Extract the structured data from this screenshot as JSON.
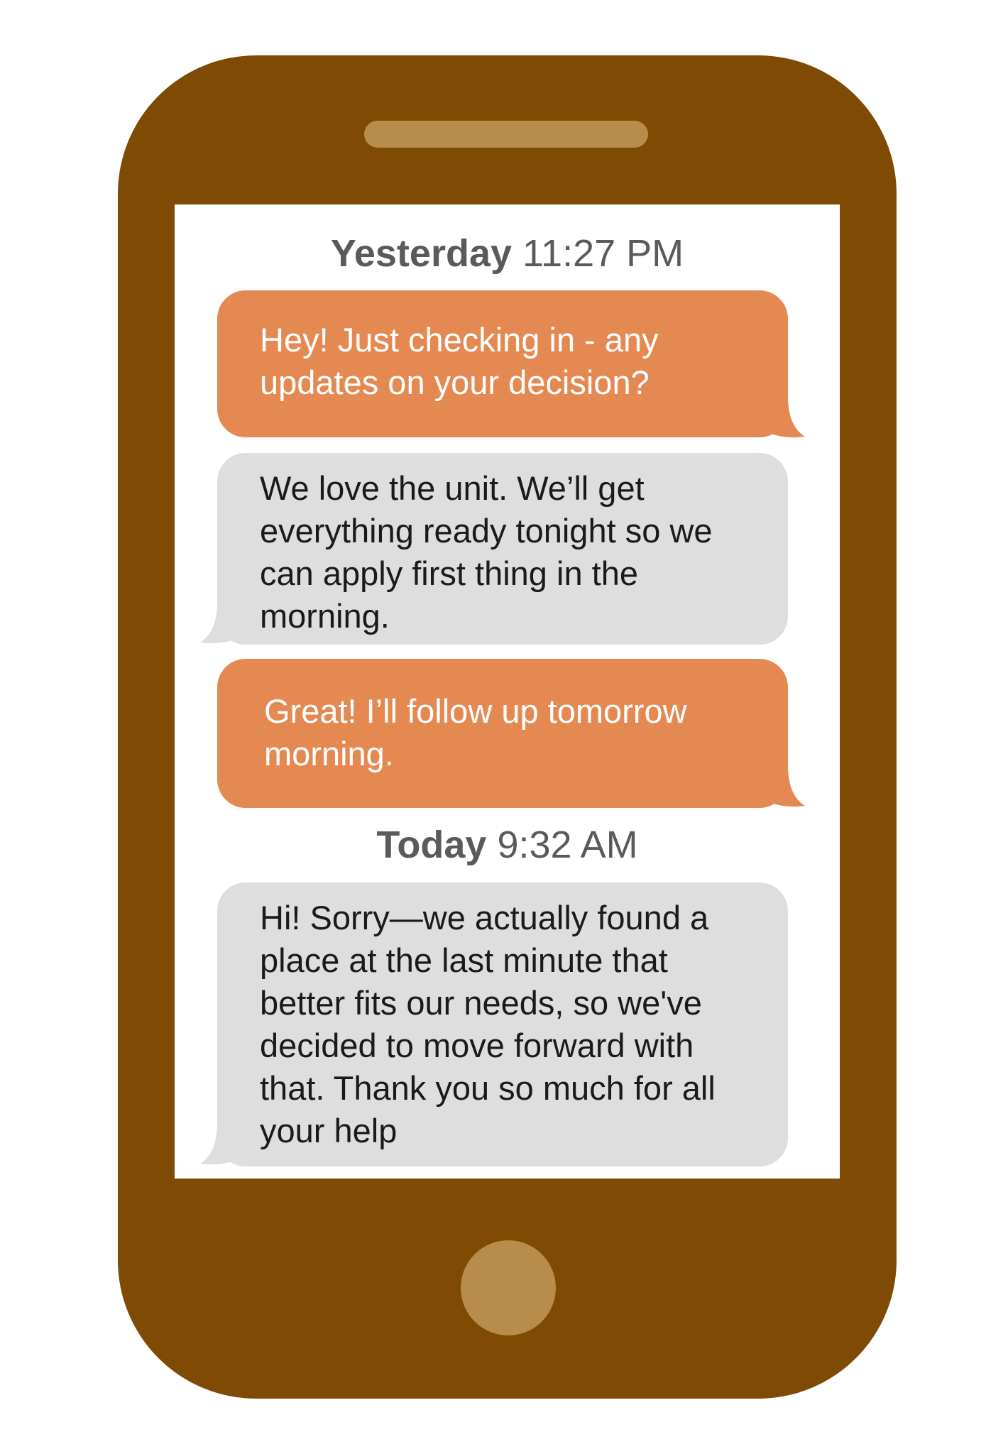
{
  "colors": {
    "phone_body": "#7f4a03",
    "speaker": "#b88c4a",
    "home_button": "#b88c4a",
    "screen": "#ffffff",
    "outgoing_bubble": "#e58952",
    "incoming_bubble": "#dededf",
    "timestamp_text": "#5a5a5a"
  },
  "conversation": {
    "yesterday": {
      "day": "Yesterday",
      "time": "11:27 PM"
    },
    "today": {
      "day": "Today",
      "time": "9:32 AM"
    },
    "messages": [
      {
        "direction": "outgoing",
        "text": "Hey! Just checking in - any updates on your decision?"
      },
      {
        "direction": "incoming",
        "text": "We love the unit. We’ll get everything ready tonight so we can apply first thing in the morning."
      },
      {
        "direction": "outgoing",
        "text": "Great! I’ll follow up tomorrow morning."
      },
      {
        "direction": "incoming",
        "text": "Hi! Sorry—we actually found a place at the last minute that better fits our needs, so we've decided to move forward with that. Thank you so much for all your help"
      }
    ]
  }
}
